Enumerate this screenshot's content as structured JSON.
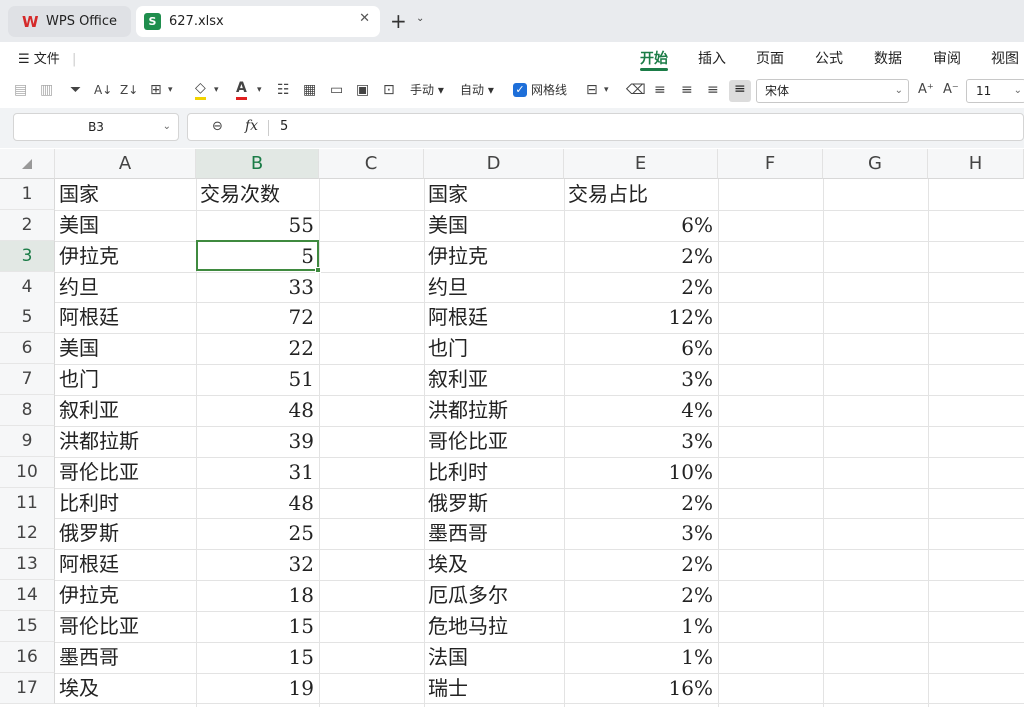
{
  "tabs": {
    "app_label": "WPS Office",
    "file_label": "627.xlsx",
    "file_icon": "S"
  },
  "menu": {
    "file_label": "文件",
    "ribbon_tabs": [
      "开始",
      "插入",
      "页面",
      "公式",
      "数据",
      "审阅",
      "视图"
    ],
    "active_tab": "开始"
  },
  "toolbar": {
    "manual_label": "手动",
    "auto_label": "自动",
    "gridlines_label": "网格线",
    "gridlines_checked": true,
    "font_name": "宋体",
    "font_size": "11"
  },
  "formula_bar": {
    "name_box": "B3",
    "fx_label": "fx",
    "value": "5"
  },
  "columns": [
    "A",
    "B",
    "C",
    "D",
    "E",
    "F",
    "G",
    "H"
  ],
  "selected_column": "B",
  "selected_row": "3",
  "rows": [
    {
      "n": "1",
      "A": "国家",
      "B": "交易次数",
      "D": "国家",
      "E": "交易占比"
    },
    {
      "n": "2",
      "A": "美国",
      "B": "55",
      "D": "美国",
      "E": "6%"
    },
    {
      "n": "3",
      "A": "伊拉克",
      "B": "5",
      "D": "伊拉克",
      "E": "2%"
    },
    {
      "n": "4",
      "A": "约旦",
      "B": "33",
      "D": "约旦",
      "E": "2%"
    },
    {
      "n": "5",
      "A": "阿根廷",
      "B": "72",
      "D": "阿根廷",
      "E": "12%"
    },
    {
      "n": "6",
      "A": "美国",
      "B": "22",
      "D": "也门",
      "E": "6%"
    },
    {
      "n": "7",
      "A": "也门",
      "B": "51",
      "D": "叙利亚",
      "E": "3%"
    },
    {
      "n": "8",
      "A": "叙利亚",
      "B": "48",
      "D": "洪都拉斯",
      "E": "4%"
    },
    {
      "n": "9",
      "A": "洪都拉斯",
      "B": "39",
      "D": "哥伦比亚",
      "E": "3%"
    },
    {
      "n": "10",
      "A": "哥伦比亚",
      "B": "31",
      "D": "比利时",
      "E": "10%"
    },
    {
      "n": "11",
      "A": "比利时",
      "B": "48",
      "D": "俄罗斯",
      "E": "2%"
    },
    {
      "n": "12",
      "A": "俄罗斯",
      "B": "25",
      "D": "墨西哥",
      "E": "3%"
    },
    {
      "n": "13",
      "A": "阿根廷",
      "B": "32",
      "D": "埃及",
      "E": "2%"
    },
    {
      "n": "14",
      "A": "伊拉克",
      "B": "18",
      "D": "厄瓜多尔",
      "E": "2%"
    },
    {
      "n": "15",
      "A": "哥伦比亚",
      "B": "15",
      "D": "危地马拉",
      "E": "1%"
    },
    {
      "n": "16",
      "A": "墨西哥",
      "B": "15",
      "D": "法国",
      "E": "1%"
    },
    {
      "n": "17",
      "A": "埃及",
      "B": "19",
      "D": "瑞士",
      "E": "16%"
    }
  ]
}
